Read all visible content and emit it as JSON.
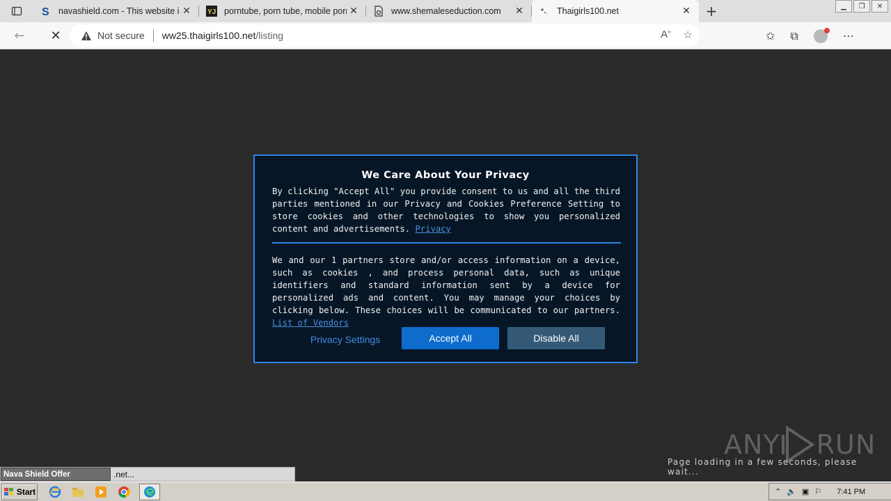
{
  "browser": {
    "tabs": [
      {
        "title": "navashield.com - This website is",
        "favicon": "navashield-s-icon"
      },
      {
        "title": "porntube, porn tube, mobile porn",
        "favicon": "yj-icon"
      },
      {
        "title": "www.shemaleseduction.com",
        "favicon": "page-icon"
      },
      {
        "title": "Thaigirls100.net",
        "favicon": "loading-icon"
      }
    ],
    "address": {
      "security_label": "Not secure",
      "url_host": "ww25.thaigirls100.net",
      "url_path": "/listing"
    }
  },
  "dialog": {
    "title": "We Care About Your Privacy",
    "paragraph1": "By clicking \"Accept All\" you provide consent to us and all the third parties mentioned in our Privacy and Cookies Preference Setting to store cookies and other technologies to show you personalized content and advertisements.",
    "privacy_link": "Privacy",
    "paragraph2": "We and our 1 partners store and/or access information on a device, such as cookies , and process personal data, such as unique identifiers and standard information sent by a device for personalized ads and content. You may manage your choices by clicking below. These choices will be communicated to our partners.",
    "vendors_link": "List of Vendors",
    "btn_privacy_settings": "Privacy Settings",
    "btn_accept_all": "Accept All",
    "btn_disable_all": "Disable All"
  },
  "watermark": {
    "brand_left": "ANY",
    "brand_right": "RUN",
    "loading_text": "Page loading in a few seconds, please wait..."
  },
  "status": {
    "nava_label": "Nava Shield Offer",
    "url_fragment": ".net..."
  },
  "taskbar": {
    "start_label": "Start",
    "clock": "7:41 PM"
  }
}
